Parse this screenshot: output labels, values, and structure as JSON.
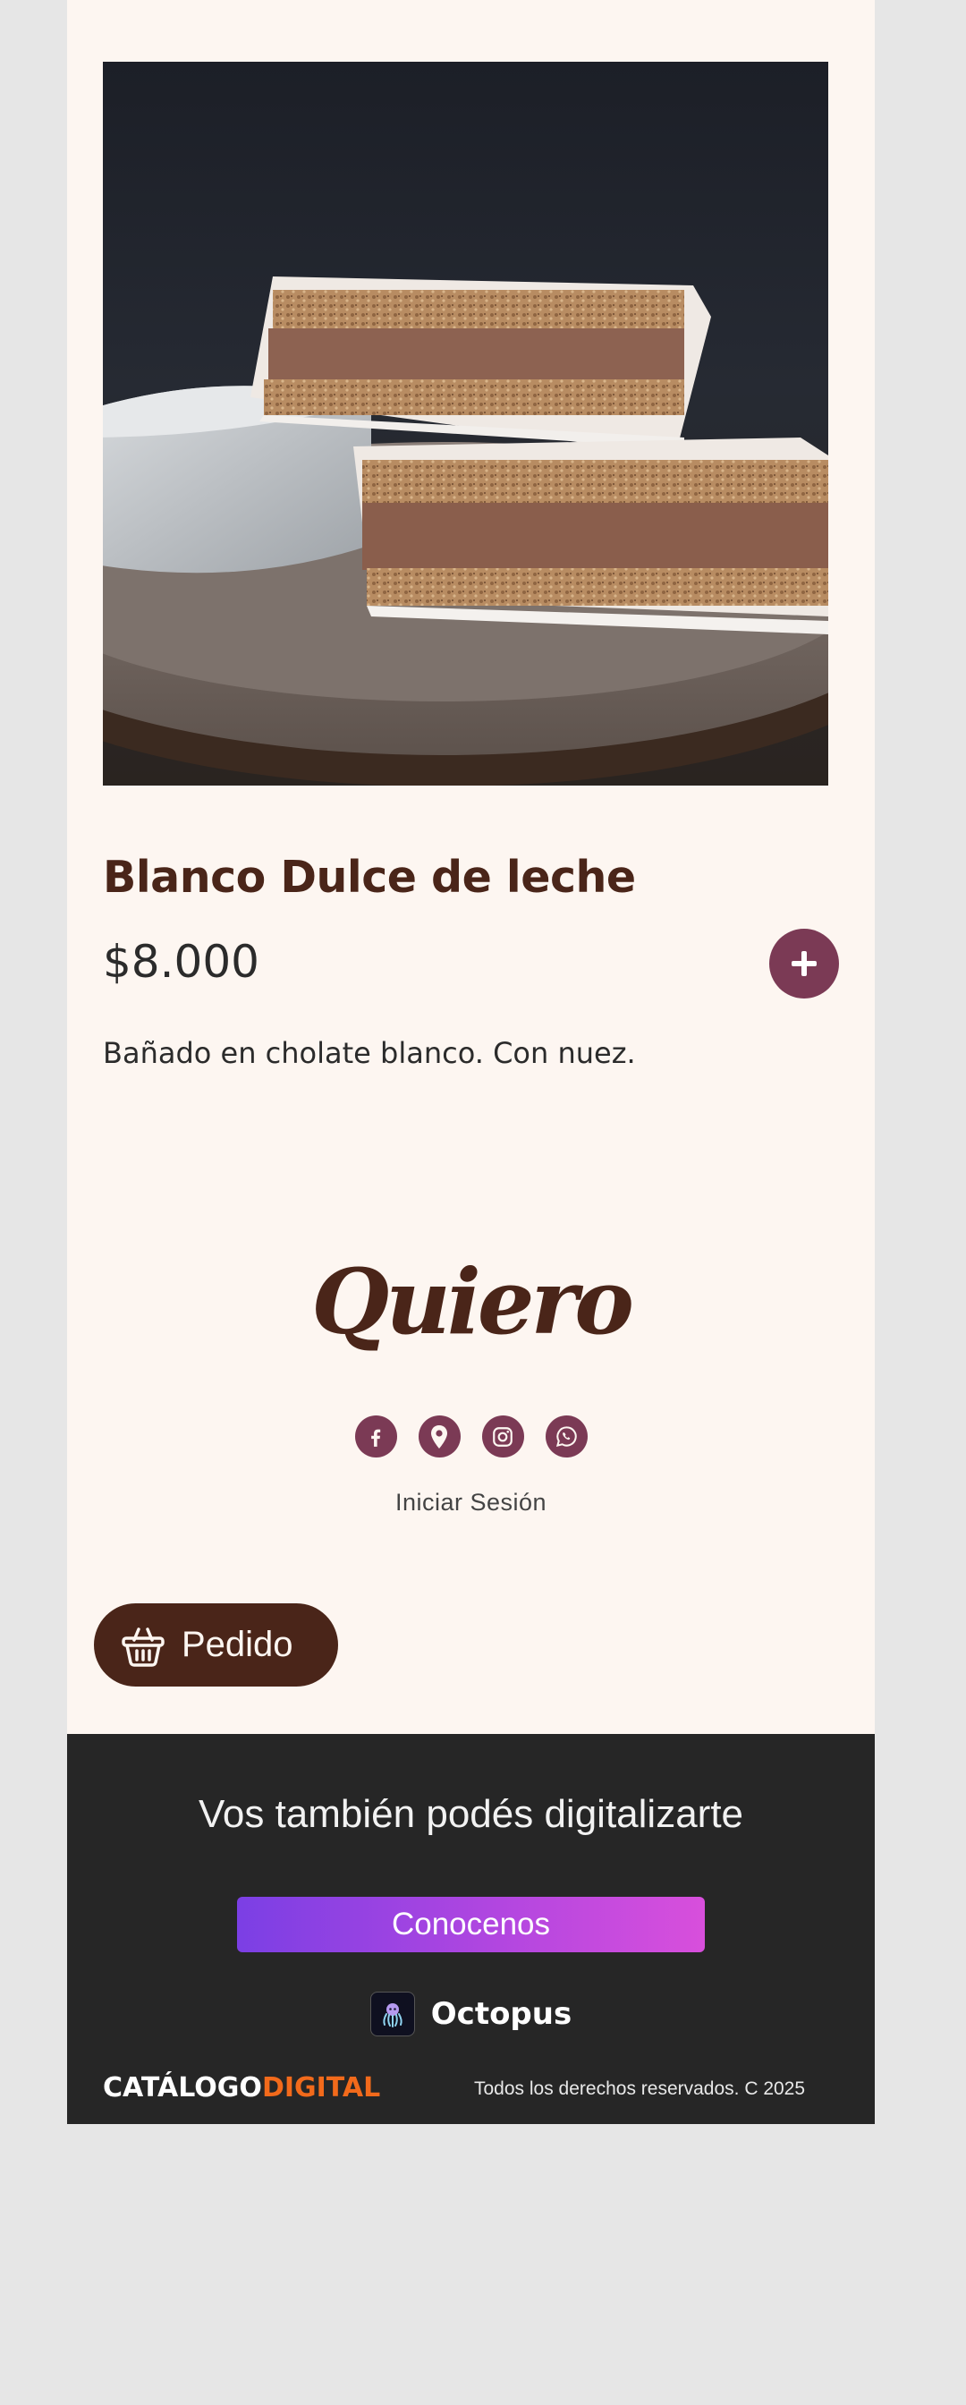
{
  "product": {
    "image_alt": "Alfajor Blanco Dulce de leche",
    "title": "Blanco Dulce de leche",
    "price": "$8.000",
    "description": "Bañado en cholate blanco. Con nuez."
  },
  "brand": {
    "logo_text": "Quiero",
    "social": [
      "facebook-icon",
      "location-pin-icon",
      "instagram-icon",
      "whatsapp-icon"
    ],
    "login_label": "Iniciar Sesión"
  },
  "order": {
    "label": "Pedido",
    "icon": "basket-icon"
  },
  "footer": {
    "promo": "Vos también podés digitalizarte",
    "cta_label": "Conocenos",
    "partner_name": "Octopus",
    "brand_part1": "CATÁLOGO",
    "brand_part2": "DIGITAL",
    "copyright": "Todos los derechos reservados. C 2025"
  },
  "colors": {
    "page_bg": "#fdf6f1",
    "accent": "#7b3a55",
    "brand_brown": "#4a2519",
    "footer_bg": "#262626",
    "digital_orange": "#f26a1b"
  }
}
